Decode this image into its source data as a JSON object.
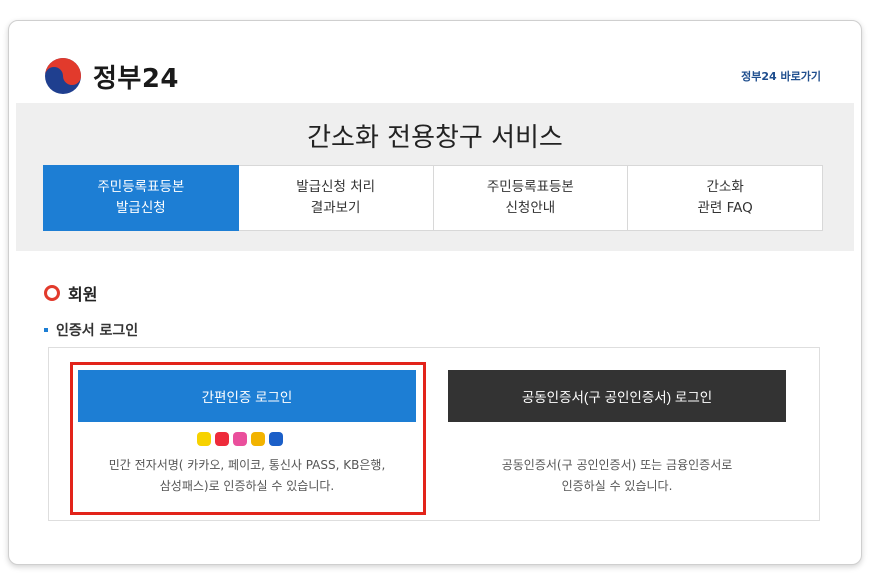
{
  "header": {
    "logo_text": "정부24",
    "shortcut_link": "정부24 바로가기"
  },
  "banner": {
    "title": "간소화 전용창구 서비스",
    "tabs": [
      {
        "line1": "주민등록표등본",
        "line2": "발급신청",
        "active": true
      },
      {
        "line1": "발급신청 처리",
        "line2": "결과보기",
        "active": false
      },
      {
        "line1": "주민등록표등본",
        "line2": "신청안내",
        "active": false
      },
      {
        "line1": "간소화",
        "line2": "관련 FAQ",
        "active": false
      }
    ]
  },
  "section": {
    "title": "회원",
    "subtitle": "인증서 로그인"
  },
  "login": {
    "simple": {
      "button": "간편인증 로그인",
      "desc_line1": "민간 전자서명( 카카오, 페이코, 통신사 PASS, KB은행,",
      "desc_line2": "삼성패스)로 인증하실 수 있습니다."
    },
    "certificate": {
      "button": "공동인증서(구 공인인증서) 로그인",
      "desc_line1": "공동인증서(구 공인인증서) 또는 금융인증서로",
      "desc_line2": "인증하실 수 있습니다."
    },
    "provider_icons": [
      {
        "name": "kakao-icon",
        "color": "#f7d200"
      },
      {
        "name": "payco-icon",
        "color": "#ee2b3b"
      },
      {
        "name": "pass-icon",
        "color": "#ea4f9c"
      },
      {
        "name": "kb-icon",
        "color": "#f2b300"
      },
      {
        "name": "samsung-pass-icon",
        "color": "#1b5fc8"
      }
    ]
  },
  "colors": {
    "primary": "#1d7ed4",
    "dark_button": "#333333",
    "highlight": "#e2231a",
    "section_circle": "#e23a2c"
  }
}
